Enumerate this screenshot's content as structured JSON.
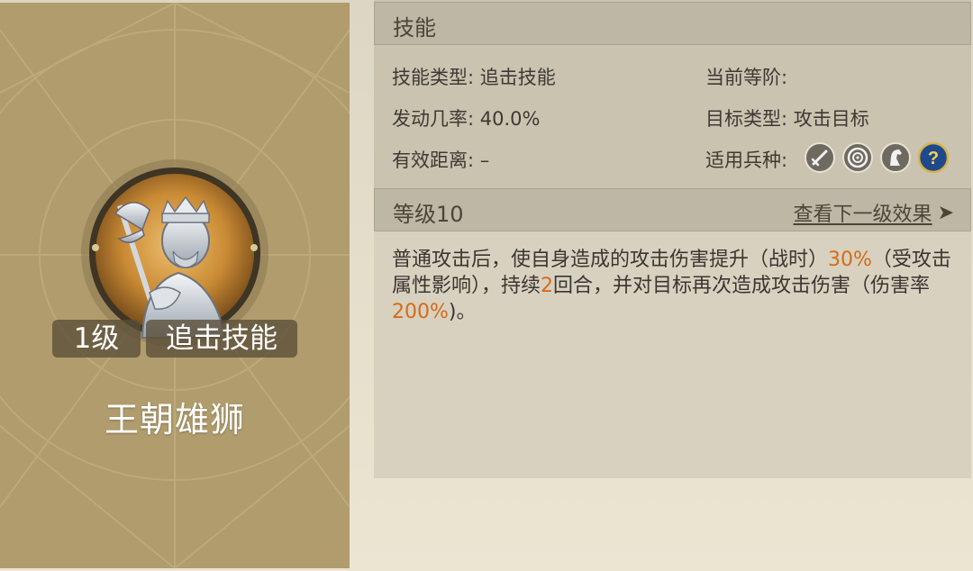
{
  "skill_card": {
    "level_tag": "1级",
    "type_tag": "追击技能",
    "name": "王朝雄狮",
    "portrait_icon": "knight-with-halberd"
  },
  "skills_section": {
    "title": "技能",
    "fields": {
      "skill_type_label": "技能类型:",
      "skill_type_value": "追击技能",
      "current_rank_label": "当前等阶:",
      "current_rank_value": "",
      "trigger_rate_label": "发动几率:",
      "trigger_rate_value": "40.0%",
      "target_type_label": "目标类型:",
      "target_type_value": "攻击目标",
      "range_label": "有效距离:",
      "range_value": "–",
      "troops_label": "适用兵种:"
    },
    "troop_icons": [
      "sword-icon",
      "target-icon",
      "horse-icon",
      "question-icon"
    ]
  },
  "level_section": {
    "title": "等级10",
    "next_link": "查看下一级效果",
    "next_arrow": "➤"
  },
  "description": {
    "p1": "普通攻击后，使自身造成的攻击伤害提升（战时）",
    "h1": "30%",
    "p2": "（受攻击属性影响），持续",
    "h2": "2",
    "p3": "回合，并对目标再次造成攻击伤害（伤害率",
    "h3": "200%",
    "p4": ")。"
  },
  "colors": {
    "highlight": "#d66a1c",
    "card_bg": "#b09c6c",
    "panel_bg": "#c9c3b0"
  }
}
